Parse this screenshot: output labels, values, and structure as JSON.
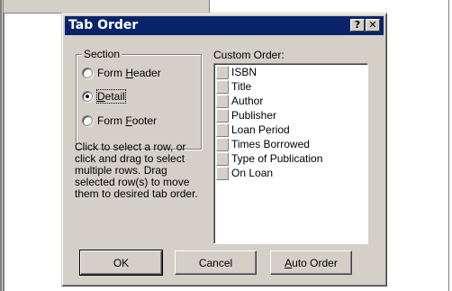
{
  "dialog": {
    "title": "Tab Order",
    "help_button": "?",
    "close_button": "✕"
  },
  "section": {
    "legend": "Section",
    "options": [
      {
        "pre": "Form ",
        "key": "H",
        "post": "eader",
        "checked": false
      },
      {
        "pre": "",
        "key": "D",
        "post": "etail",
        "checked": true
      },
      {
        "pre": "Form ",
        "key": "F",
        "post": "ooter",
        "checked": false
      }
    ]
  },
  "help_text": "Click to select a row, or click and drag to select multiple rows.  Drag selected row(s) to move them to desired tab order.",
  "custom_order": {
    "label": "Custom Order:",
    "items": [
      "ISBN",
      "Title",
      "Author",
      "Publisher",
      "Loan Period",
      "Times Borrowed",
      "Type of Publication",
      "On Loan"
    ]
  },
  "buttons": {
    "ok": "OK",
    "cancel": "Cancel",
    "auto_order_key": "A",
    "auto_order_rest": "uto Order"
  }
}
